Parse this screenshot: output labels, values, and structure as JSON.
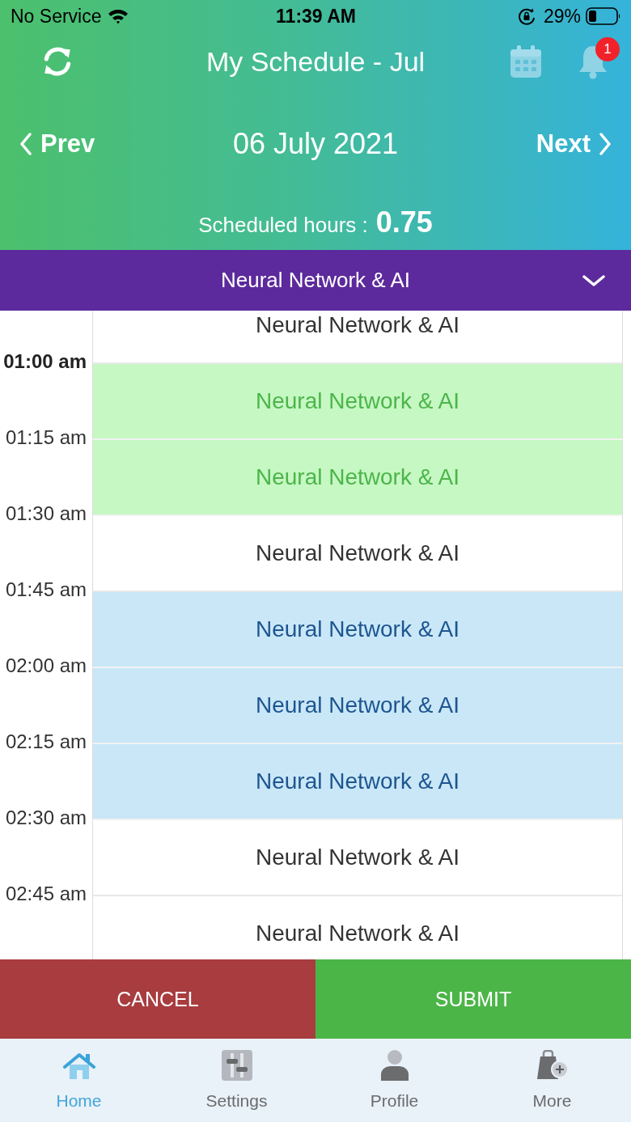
{
  "status_bar": {
    "carrier": "No Service",
    "time": "11:39 AM",
    "battery": "29%"
  },
  "header": {
    "title": "My Schedule - Jul",
    "notification_count": "1"
  },
  "date_nav": {
    "prev": "Prev",
    "date": "06 July 2021",
    "next": "Next"
  },
  "summary": {
    "label": "Scheduled hours :",
    "value": "0.75"
  },
  "course_picker": {
    "value": "Neural Network & AI"
  },
  "slots": [
    {
      "title": "Neural Network & AI",
      "kind": "open",
      "end_time": "01:00 am",
      "current": true
    },
    {
      "title": "Neural Network & AI",
      "kind": "selected",
      "end_time": "01:15 am",
      "current": false
    },
    {
      "title": "Neural Network & AI",
      "kind": "selected",
      "end_time": "01:30 am",
      "current": false
    },
    {
      "title": "Neural Network & AI",
      "kind": "open",
      "end_time": "01:45 am",
      "current": false
    },
    {
      "title": "Neural Network & AI",
      "kind": "scheduled",
      "end_time": "02:00 am",
      "current": false
    },
    {
      "title": "Neural Network & AI",
      "kind": "scheduled",
      "end_time": "02:15 am",
      "current": false
    },
    {
      "title": "Neural Network & AI",
      "kind": "scheduled",
      "end_time": "02:30 am",
      "current": false
    },
    {
      "title": "Neural Network & AI",
      "kind": "open",
      "end_time": "02:45 am",
      "current": false
    },
    {
      "title": "Neural Network & AI",
      "kind": "open"
    }
  ],
  "actions": {
    "cancel": "CANCEL",
    "submit": "SUBMIT"
  },
  "tabs": [
    {
      "label": "Home",
      "selected": true
    },
    {
      "label": "Settings",
      "selected": false
    },
    {
      "label": "Profile",
      "selected": false
    },
    {
      "label": "More",
      "selected": false
    }
  ]
}
